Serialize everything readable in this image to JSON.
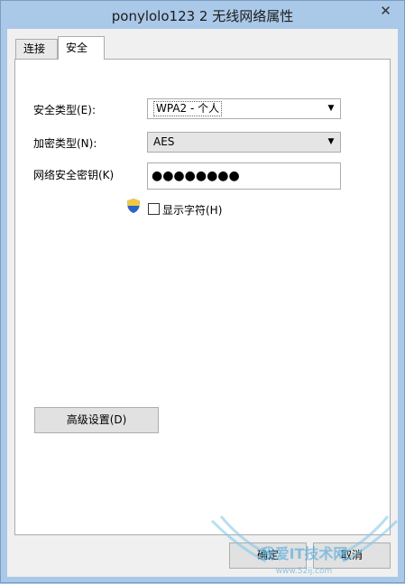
{
  "window": {
    "title": "ponylolo123 2 无线网络属性",
    "close_glyph": "✕"
  },
  "tabs": [
    {
      "label": "连接"
    },
    {
      "label": "安全"
    }
  ],
  "security": {
    "type_label": "安全类型(E):",
    "type_value": "WPA2 - 个人",
    "encryption_label": "加密类型(N):",
    "encryption_value": "AES",
    "key_label": "网络安全密钥(K)",
    "key_value": "●●●●●●●●",
    "show_chars_label": "显示字符(H)",
    "show_chars_checked": false
  },
  "buttons": {
    "advanced": "高级设置(D)",
    "ok": "确定",
    "cancel": "取消"
  },
  "icons": {
    "shield": "uac-shield-icon",
    "dropdown": "chevron-down-icon",
    "close": "close-icon"
  },
  "watermark": {
    "text": "我爱IT技术网",
    "url": "www.52ij.com"
  }
}
